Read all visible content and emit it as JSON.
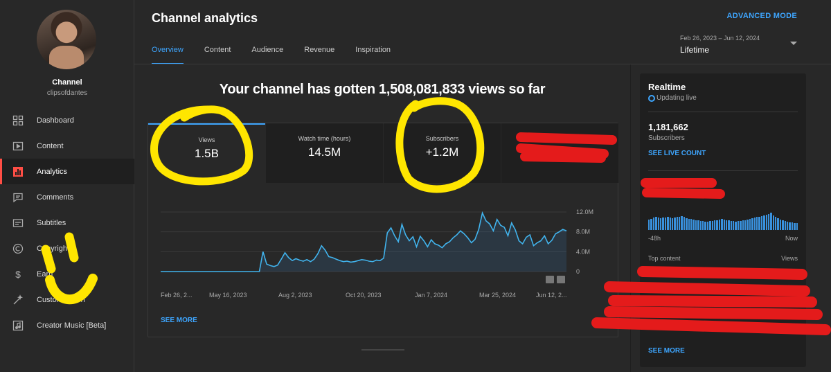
{
  "channel": {
    "name": "Channel",
    "handle": "clipsofdantes"
  },
  "sidebar": {
    "items": [
      {
        "label": "Dashboard",
        "icon": "dashboard-icon"
      },
      {
        "label": "Content",
        "icon": "content-icon"
      },
      {
        "label": "Analytics",
        "icon": "analytics-icon",
        "active": true
      },
      {
        "label": "Comments",
        "icon": "comments-icon"
      },
      {
        "label": "Subtitles",
        "icon": "subtitles-icon"
      },
      {
        "label": "Copyright",
        "icon": "copyright-icon"
      },
      {
        "label": "Earn",
        "icon": "earn-icon"
      },
      {
        "label": "Customization",
        "icon": "customization-icon"
      },
      {
        "label": "Creator Music [Beta]",
        "icon": "music-icon"
      }
    ]
  },
  "header": {
    "title": "Channel analytics",
    "advanced_mode": "ADVANCED MODE",
    "tabs": [
      "Overview",
      "Content",
      "Audience",
      "Revenue",
      "Inspiration"
    ],
    "date_range": "Feb 26, 2023 – Jun 12, 2024",
    "period": "Lifetime"
  },
  "overview": {
    "headline": "Your channel has gotten 1,508,081,833 views so far",
    "metrics": [
      {
        "label": "Views",
        "value": "1.5B"
      },
      {
        "label": "Watch time (hours)",
        "value": "14.5M"
      },
      {
        "label": "Subscribers",
        "value": "+1.2M"
      }
    ],
    "see_more": "SEE MORE"
  },
  "chart_data": {
    "type": "area",
    "x": [
      "Feb 26, 2...",
      "May 16, 2023",
      "Aug 2, 2023",
      "Oct 20, 2023",
      "Jan 7, 2024",
      "Mar 25, 2024",
      "Jun 12, 2..."
    ],
    "y_ticks": [
      "12.0M",
      "8.0M",
      "4.0M",
      "0"
    ],
    "ylim": [
      0,
      12000000
    ],
    "grid": true,
    "series": [
      {
        "values": [
          0,
          0,
          0,
          0,
          0,
          0,
          0,
          0,
          0,
          0,
          0,
          0,
          0,
          0,
          0,
          0,
          0,
          0,
          0,
          0,
          0,
          0,
          0,
          0,
          0,
          0,
          0,
          0,
          4000000,
          1500000,
          1200000,
          1000000,
          1300000,
          2500000,
          3800000,
          2800000,
          2200000,
          2600000,
          2300000,
          2100000,
          2400000,
          2000000,
          2500000,
          3600000,
          5200000,
          4300000,
          3000000,
          2800000,
          2500000,
          2200000,
          2000000,
          2100000,
          1900000,
          2000000,
          2200000,
          2400000,
          2300000,
          2100000,
          2000000,
          2300000,
          2200000,
          2700000,
          7800000,
          8800000,
          7200000,
          6000000,
          9500000,
          7400000,
          6200000,
          7000000,
          5000000,
          7100000,
          6200000,
          5000000,
          6400000,
          5600000,
          5300000,
          4800000,
          5600000,
          6000000,
          6800000,
          7400000,
          8200000,
          7600000,
          6800000,
          5800000,
          6500000,
          8500000,
          11800000,
          10200000,
          9600000,
          8200000,
          10500000,
          9300000,
          8900000,
          7200000,
          9800000,
          8400000,
          6200000,
          5600000,
          6900000,
          7400000,
          5200000,
          5800000,
          6200000,
          7200000,
          5600000,
          6300000,
          7600000,
          8000000,
          8500000,
          8200000
        ]
      }
    ]
  },
  "realtime": {
    "title": "Realtime",
    "status": "Updating live",
    "count": "1,181,662",
    "count_label": "Subscribers",
    "live_count": "SEE LIVE COUNT",
    "bars": [
      0.5,
      0.55,
      0.6,
      0.62,
      0.6,
      0.58,
      0.6,
      0.61,
      0.62,
      0.6,
      0.58,
      0.6,
      0.62,
      0.64,
      0.66,
      0.62,
      0.58,
      0.55,
      0.52,
      0.5,
      0.48,
      0.46,
      0.44,
      0.42,
      0.4,
      0.4,
      0.42,
      0.44,
      0.46,
      0.48,
      0.5,
      0.52,
      0.5,
      0.48,
      0.46,
      0.44,
      0.42,
      0.4,
      0.42,
      0.44,
      0.46,
      0.48,
      0.5,
      0.52,
      0.56,
      0.6,
      0.62,
      0.64,
      0.66,
      0.7,
      0.74,
      0.78,
      0.82,
      0.7,
      0.62,
      0.56,
      0.5,
      0.46,
      0.42,
      0.4,
      0.38,
      0.36,
      0.34,
      0.32
    ],
    "range_start": "-48h",
    "range_end": "Now",
    "top_content": "Top content",
    "views_label": "Views",
    "see_more": "SEE MORE"
  }
}
